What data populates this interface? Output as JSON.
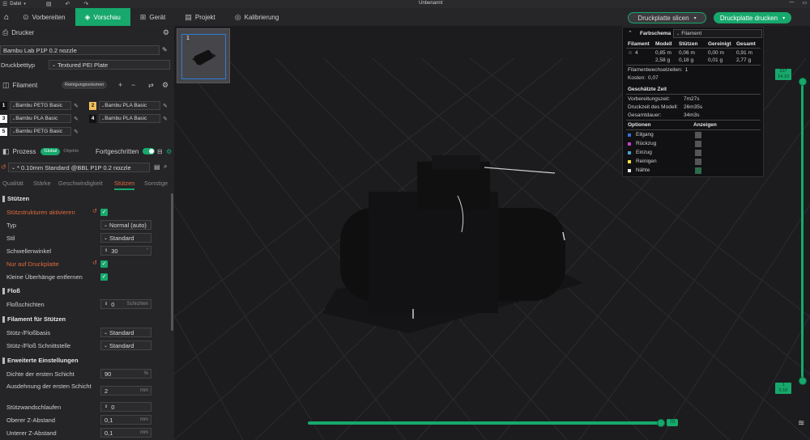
{
  "titlebar": {
    "menu_icon": "hamburger-icon",
    "file_menu": "Datei",
    "title": "Unbenannt"
  },
  "tabs": [
    {
      "label": "Vorbereiten",
      "icon": "home-icon"
    },
    {
      "label": "Vorschau",
      "icon": "cube-icon",
      "active": true
    },
    {
      "label": "Gerät",
      "icon": "device-icon"
    },
    {
      "label": "Projekt",
      "icon": "document-icon"
    },
    {
      "label": "Kalibrierung",
      "icon": "calibration-icon"
    }
  ],
  "actions": {
    "slice_label": "Druckplatte slicen",
    "print_label": "Druckplatte drucken"
  },
  "printer": {
    "section_label": "Drucker",
    "name": "Bambu Lab P1P 0.2 nozzle",
    "bed_label": "Druckbetttyp",
    "bed_value": "Textured PEI Plate"
  },
  "filament": {
    "section_label": "Filament",
    "purge_label": "Reinigungsvolumen",
    "items": [
      {
        "num": "1",
        "name": "Bambu PETG Basic",
        "color": "#111111",
        "numcolor": "#ffffff"
      },
      {
        "num": "2",
        "name": "Bambu PLA Basic",
        "color": "#f0c05a",
        "numcolor": "#222222"
      },
      {
        "num": "3",
        "name": "Bambu PLA Basic",
        "color": "#ffffff",
        "numcolor": "#111111"
      },
      {
        "num": "4",
        "name": "Bambu PLA Basic",
        "color": "#111111",
        "numcolor": "#ffffff"
      },
      {
        "num": "5",
        "name": "Bambu PETG Basic",
        "color": "#ffffff",
        "numcolor": "#111111"
      }
    ]
  },
  "process": {
    "section_label": "Prozess",
    "global_label": "Global",
    "objects_label": "Objekte",
    "advanced_label": "Fortgeschritten",
    "preset": "* 0.10mm Standard @BBL P1P 0.2 nozzle",
    "subtabs": [
      "Qualität",
      "Stärke",
      "Geschwindigkeit",
      "Stützen",
      "Sonstige"
    ]
  },
  "support": {
    "header": "Stützen",
    "enable_label": "Stützstrukturen aktivieren",
    "type_label": "Typ",
    "type_value": "Normal (auto)",
    "style_label": "Stil",
    "style_value": "Standard",
    "threshold_label": "Schwellenwinkel",
    "threshold_value": "30",
    "build_plate_only_label": "Nur auf Druckplatte",
    "remove_small_label": "Kleine Überhänge entfernen"
  },
  "raft": {
    "header": "Floß",
    "layers_label": "Floßschichten",
    "layers_value": "0",
    "layers_unit": "Schichten"
  },
  "support_filament": {
    "header": "Filament für Stützen",
    "base_label": "Stütz-/Floßbasis",
    "base_value": "Standard",
    "interface_label": "Stütz-/Floß Schnittstelle",
    "interface_value": "Standard"
  },
  "advanced": {
    "header": "Erweiterte Einstellungen",
    "first_layer_density_label": "Dichte der ersten Schicht",
    "first_layer_density_value": "90",
    "first_layer_density_unit": "%",
    "first_layer_expansion_label": "Ausdehnung der ersten Schicht",
    "first_layer_expansion_value": "2",
    "first_layer_expansion_unit": "mm",
    "wall_loops_label": "Stützwandschlaufen",
    "wall_loops_value": "0",
    "top_z_label": "Oberer Z-Abstand",
    "top_z_value": "0,1",
    "top_z_unit": "mm",
    "bottom_z_label": "Unterer Z-Abstand",
    "bottom_z_value": "0,1",
    "bottom_z_unit": "mm"
  },
  "plate": {
    "number": "1"
  },
  "legend": {
    "title": "Farbschema",
    "scheme": "Filament",
    "col_filament": "Filament",
    "col_model": "Modell",
    "col_support": "Stützen",
    "col_purged": "Gereinigt",
    "col_total": "Gesamt",
    "row_num": "4",
    "model_m": "0,85 m",
    "model_g": "2,58 g",
    "support_m": "0,06 m",
    "support_g": "0,18 g",
    "purged_m": "0,00 m",
    "purged_g": "0,01 g",
    "total_m": "0,91 m",
    "total_g": "2,77 g",
    "changes_label": "Filamentwechselzeiten:",
    "changes_value": "1",
    "cost_label": "Kosten:",
    "cost_value": "0,07",
    "time_header": "Geschätzte Zeit",
    "prep_label": "Vorbereitungszeit:",
    "prep_value": "7m27s",
    "model_time_label": "Druckzeit des Modell:",
    "model_time_value": "26m35s",
    "total_time_label": "Gesamtdauer:",
    "total_time_value": "34m3s",
    "options_label": "Optionen",
    "show_label": "Anzeigen",
    "options": [
      {
        "name": "Eilgang",
        "color": "#3b6fd6"
      },
      {
        "name": "Rückzug",
        "color": "#c93fc9"
      },
      {
        "name": "Einzug",
        "color": "#3fa6c9"
      },
      {
        "name": "Reinigen",
        "color": "#f0e040"
      },
      {
        "name": "Nähte",
        "color": "#e8e8e8"
      }
    ]
  },
  "layer_slider": {
    "top_layer": "227",
    "top_height": "14.10",
    "bottom_layer": "1",
    "bottom_height": "0.10"
  },
  "move_slider": {
    "value": "70"
  }
}
